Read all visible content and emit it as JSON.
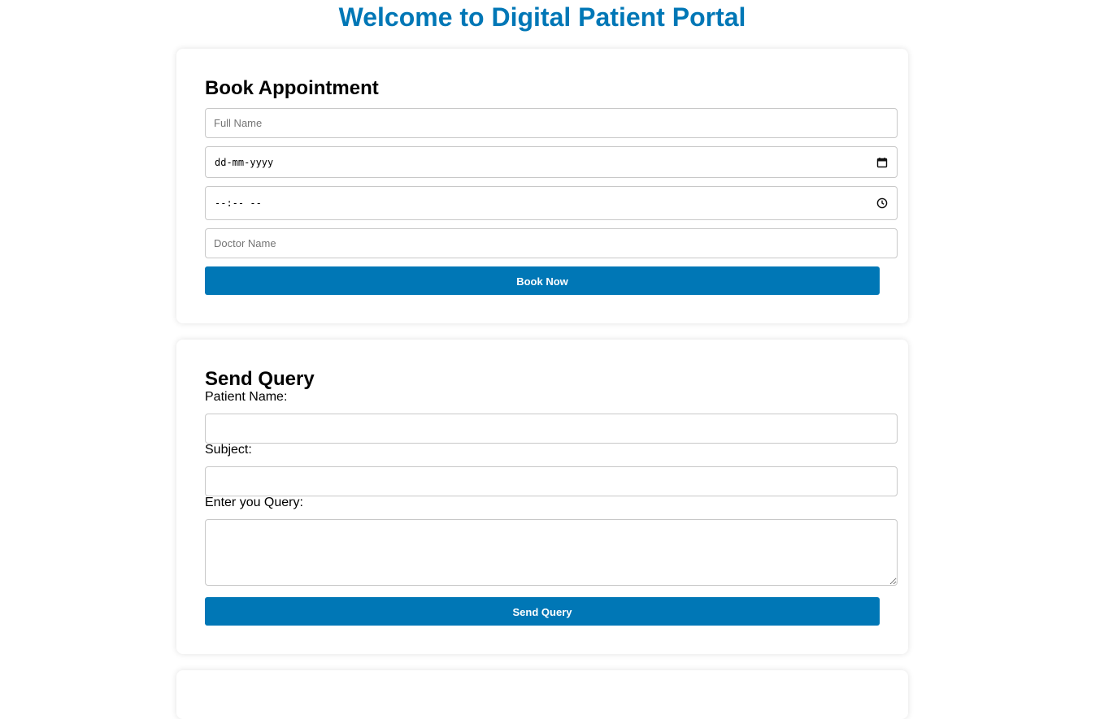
{
  "page": {
    "title": "Welcome to Digital Patient Portal"
  },
  "colors": {
    "accent": "#0077b6",
    "title": "#0077b6",
    "border": "#c8c8c8",
    "background": "#ffffff"
  },
  "book_appointment": {
    "heading": "Book Appointment",
    "full_name_placeholder": "Full Name",
    "date_placeholder": "dd-mm-yyyy",
    "time_placeholder": "--:-- --",
    "doctor_name_placeholder": "Doctor Name",
    "button_label": "Book Now",
    "icons": {
      "date": "calendar-icon",
      "time": "clock-icon"
    }
  },
  "send_query": {
    "heading": "Send Query",
    "patient_name_label": "Patient Name:",
    "subject_label": "Subject:",
    "query_label": "Enter you Query:",
    "button_label": "Send Query"
  }
}
